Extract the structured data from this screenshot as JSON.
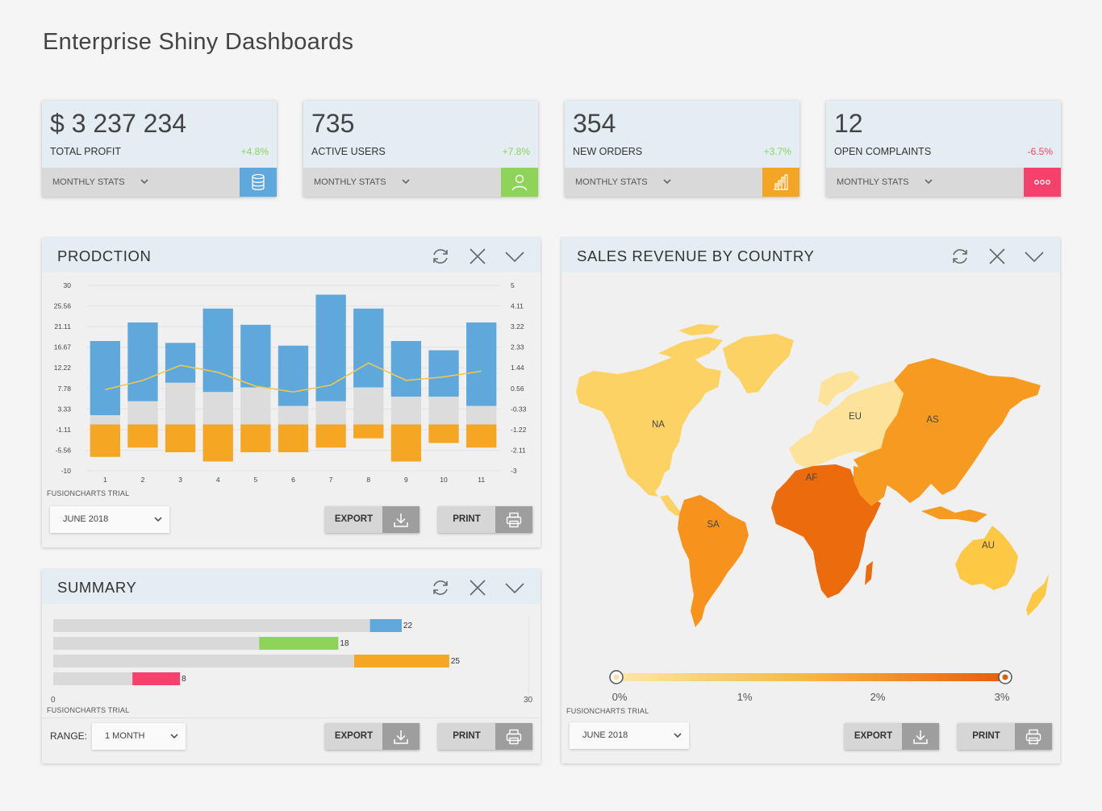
{
  "page": {
    "title": "Enterprise Shiny Dashboards"
  },
  "kpis": [
    {
      "value": "$ 3 237 234",
      "label": "TOTAL PROFIT",
      "delta": "+4.8%",
      "delta_color": "#8dd35f",
      "stats_label": "MONTHLY STATS",
      "icon": "database-icon",
      "icon_bg": "#5fa8db"
    },
    {
      "value": "735",
      "label": "ACTIVE USERS",
      "delta": "+7.8%",
      "delta_color": "#8dd35f",
      "stats_label": "MONTHLY STATS",
      "icon": "user-icon",
      "icon_bg": "#8fd45a"
    },
    {
      "value": "354",
      "label": "NEW ORDERS",
      "delta": "+3.7%",
      "delta_color": "#8dd35f",
      "stats_label": "MONTHLY STATS",
      "icon": "building-icon",
      "icon_bg": "#f3a623"
    },
    {
      "value": "12",
      "label": "OPEN COMPLAINTS",
      "delta": "-6.5%",
      "delta_color": "#f44266",
      "stats_label": "MONTHLY STATS",
      "icon": "ellipsis-icon",
      "icon_bg": "#f6416c"
    }
  ],
  "production": {
    "title": "PRODCTION",
    "trial": "FUSIONCHARTS TRIAL",
    "month_select": "JUNE 2018",
    "export_label": "EXPORT",
    "print_label": "PRINT"
  },
  "summary": {
    "title": "SUMMARY",
    "trial": "FUSIONCHARTS TRIAL",
    "axis_min": "0",
    "axis_max": "30",
    "range_label": "RANGE:",
    "range_select": "1 MONTH",
    "export_label": "EXPORT",
    "print_label": "PRINT"
  },
  "sales": {
    "title": "SALES REVENUE BY COUNTRY",
    "trial": "FUSIONCHARTS TRIAL",
    "month_select": "JUNE 2018",
    "export_label": "EXPORT",
    "print_label": "PRINT",
    "legend_ticks": [
      "0%",
      "1%",
      "2%",
      "3%"
    ],
    "legend_colors": [
      "#fde8a6",
      "#f8b640",
      "#e95c0b"
    ],
    "regions": [
      {
        "code": "NA",
        "color": "#fdd264"
      },
      {
        "code": "SA",
        "color": "#f7931c"
      },
      {
        "code": "EU",
        "color": "#fde39a"
      },
      {
        "code": "AF",
        "color": "#ec6b0c"
      },
      {
        "code": "AS",
        "color": "#f79b20"
      },
      {
        "code": "AU",
        "color": "#fdc843"
      }
    ]
  },
  "chart_data": [
    {
      "type": "bar",
      "title": "PRODCTION",
      "categories": [
        "1",
        "2",
        "3",
        "4",
        "5",
        "6",
        "7",
        "8",
        "9",
        "10",
        "11"
      ],
      "stacked": true,
      "y_ticks": [
        "30",
        "25.56",
        "21.11",
        "16.67",
        "12.22",
        "7.78",
        "3.33",
        "-1.11",
        "-5.56",
        "-10"
      ],
      "y2_ticks": [
        "5",
        "4.11",
        "3.22",
        "2.33",
        "1.44",
        "0.56",
        "-0.33",
        "-1.22",
        "-2.11",
        "-3"
      ],
      "ylim": [
        -10,
        30
      ],
      "y2lim": [
        -3,
        5
      ],
      "colors": [
        "#5fa8db",
        "#dcdcdc",
        "#f5a623",
        "#f0c84d"
      ],
      "series": [
        {
          "values": [
            16,
            17,
            8.6,
            18,
            13.5,
            13,
            23,
            17,
            12,
            10,
            18
          ]
        },
        {
          "values": [
            2,
            5,
            9,
            7,
            8,
            4,
            5,
            8,
            6,
            6,
            4
          ]
        },
        {
          "values": [
            -7,
            -5,
            -6,
            -8,
            -6,
            -6,
            -5,
            -3,
            -8,
            -4,
            -5
          ]
        },
        {
          "type": "line",
          "axis": "secondary",
          "values": [
            0.5,
            0.9,
            1.55,
            1.25,
            0.65,
            0.4,
            0.7,
            1.65,
            0.9,
            1.05,
            1.3
          ]
        }
      ]
    },
    {
      "type": "bar",
      "title": "SUMMARY",
      "orientation": "horizontal",
      "xlim": [
        0,
        30
      ],
      "values": [
        22,
        18,
        25,
        8
      ],
      "targets": [
        20,
        13,
        19,
        5
      ],
      "colors": [
        "#5fa8db",
        "#8fd45a",
        "#f5a623",
        "#f6416c"
      ]
    }
  ]
}
